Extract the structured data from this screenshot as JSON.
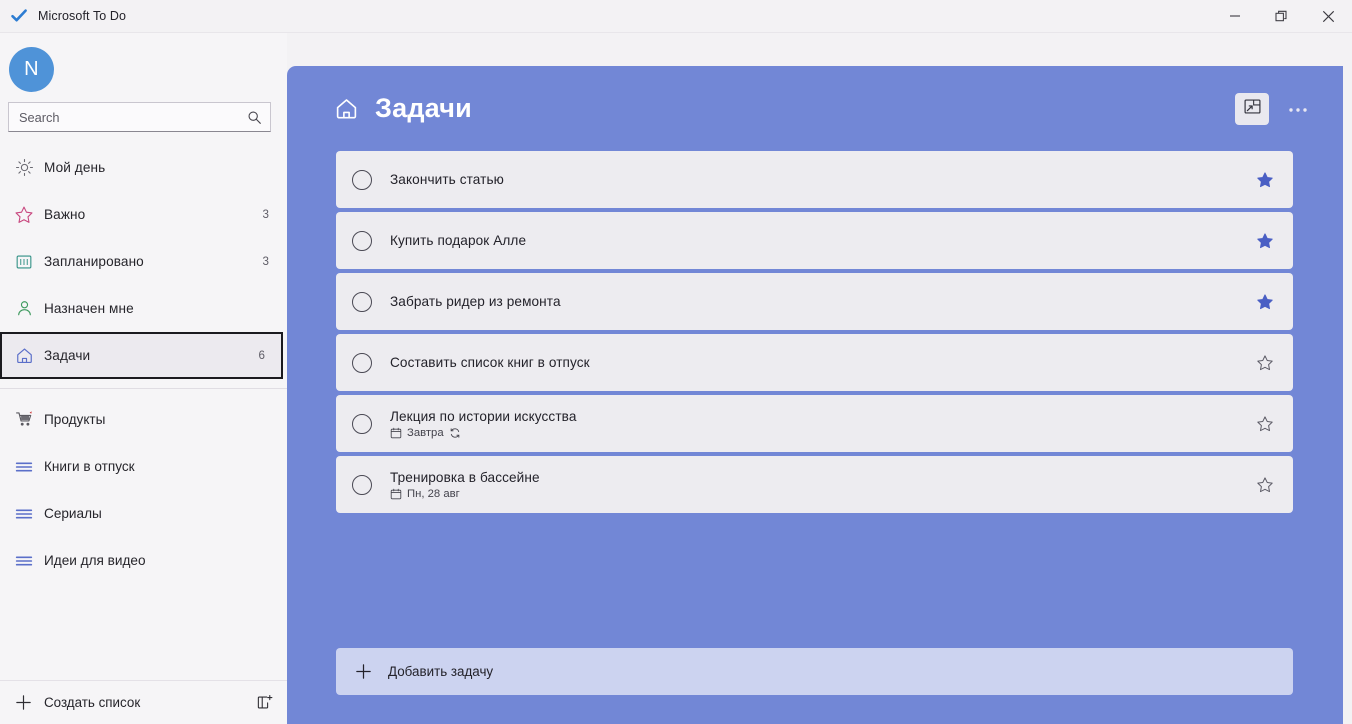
{
  "window": {
    "app_title": "Microsoft To Do",
    "logo_icon": "checkmark-icon",
    "minimize_label": "—",
    "restore_label": "❐",
    "close_label": "✕"
  },
  "sidebar": {
    "avatar_initial": "N",
    "search": {
      "placeholder": "Search",
      "value": "",
      "icon": "search-icon"
    },
    "smart_lists": [
      {
        "label": "Мой день",
        "count": "",
        "icon": "sun-icon",
        "color": "#6b6a72",
        "selected": false
      },
      {
        "label": "Важно",
        "count": "3",
        "icon": "star-icon",
        "color": "#c8467e",
        "selected": false
      },
      {
        "label": "Запланировано",
        "count": "3",
        "icon": "calendar-icon",
        "color": "#2f8f84",
        "selected": false
      },
      {
        "label": "Назначен мне",
        "count": "",
        "icon": "person-icon",
        "color": "#3f9a5f",
        "selected": false
      },
      {
        "label": "Задачи",
        "count": "6",
        "icon": "home-icon",
        "color": "#5b6fc9",
        "selected": true
      }
    ],
    "custom_lists": [
      {
        "label": "Продукты",
        "icon": "shopping-cart-icon"
      },
      {
        "label": "Книги в отпуск",
        "icon": "list-icon"
      },
      {
        "label": "Сериалы",
        "icon": "list-icon"
      },
      {
        "label": "Идеи для видео",
        "icon": "list-icon"
      }
    ],
    "new_list": {
      "label": "Создать список",
      "plus_icon": "plus-icon",
      "group_icon": "new-group-icon"
    }
  },
  "main": {
    "page_title": "Задачи",
    "page_icon": "home-icon",
    "theme_button_icon": "theme-icon",
    "more_button_icon": "ellipsis-icon",
    "background_color": "#7287d6",
    "tasks": [
      {
        "title": "Закончить статью",
        "due": "",
        "repeat": false,
        "starred": true,
        "completed": false
      },
      {
        "title": "Купить подарок Алле",
        "due": "",
        "repeat": false,
        "starred": true,
        "completed": false
      },
      {
        "title": "Забрать ридер из ремонта",
        "due": "",
        "repeat": false,
        "starred": true,
        "completed": false
      },
      {
        "title": "Составить список книг в отпуск",
        "due": "",
        "repeat": false,
        "starred": false,
        "completed": false
      },
      {
        "title": "Лекция по истории искусства",
        "due": "Завтра",
        "repeat": true,
        "starred": false,
        "completed": false
      },
      {
        "title": "Тренировка в бассейне",
        "due": "Пн, 28 авг",
        "repeat": false,
        "starred": false,
        "completed": false
      }
    ],
    "add_task": {
      "label": "Добавить задачу",
      "icon": "plus-icon"
    }
  }
}
